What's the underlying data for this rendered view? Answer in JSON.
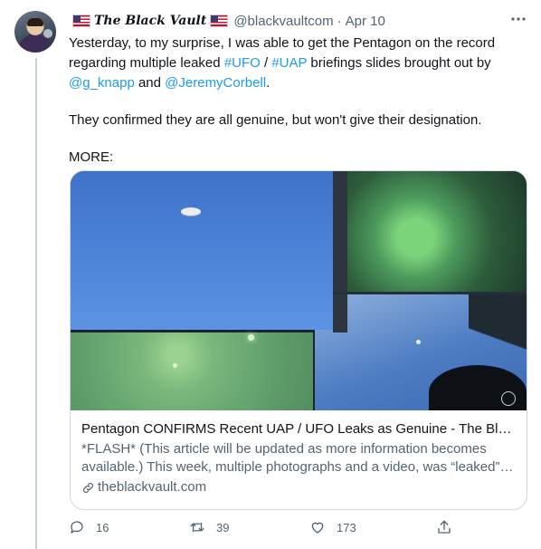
{
  "tweet": {
    "display_name": "The Black Vault",
    "handle": "@blackvaultcom",
    "separator": "·",
    "date": "Apr 10",
    "text": {
      "l1_a": "Yesterday, to my surprise, I was able to get the Pentagon on the record",
      "l2_a": "regarding multiple leaked ",
      "tag1": "#UFO",
      "l2_b": " / ",
      "tag2": "#UAP",
      "l2_c": " briefings slides brought out by",
      "mention1": "@g_knapp",
      "l3_b": " and ",
      "mention2": "@JeremyCorbell",
      "l3_c": ".",
      "p2": "They confirmed they are all genuine, but won't give their designation.",
      "p3": "MORE:"
    }
  },
  "card": {
    "title": "Pentagon CONFIRMS Recent UAP / UFO Leaks as Genuine - The Black ...",
    "desc_1": "*FLASH* (This article will be updated as more information becomes",
    "desc_2": "available.) This week, multiple photographs and a video, was “leaked” t...",
    "domain": "theblackvault.com"
  },
  "actions": {
    "replies": "16",
    "retweets": "39",
    "likes": "173"
  },
  "icons": {
    "more": "more-horizontal-icon",
    "reply": "reply-icon",
    "retweet": "retweet-icon",
    "like": "heart-icon",
    "share": "share-icon",
    "link": "link-icon",
    "flag": "us-flag-icon"
  },
  "colors": {
    "link": "#1d9bf0",
    "secondary_text": "#536471",
    "primary_text": "#0f1419",
    "border": "#cfd9de"
  }
}
